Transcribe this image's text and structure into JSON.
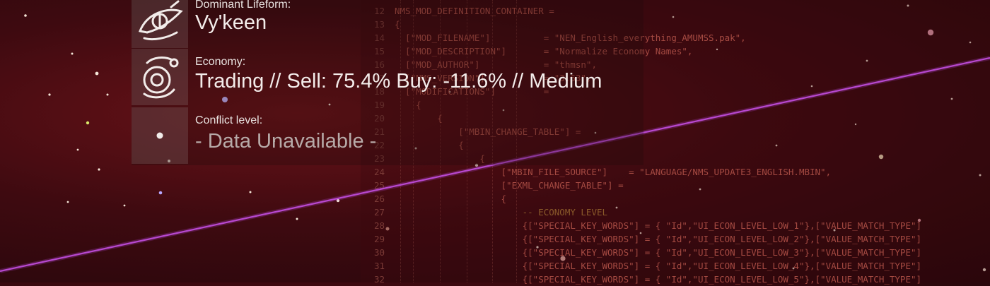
{
  "hud": {
    "rows": [
      {
        "label": "Dominant Lifeform:",
        "value": "Vy'keen",
        "icon": "vykeen-eye-icon"
      },
      {
        "label": "Economy:",
        "value": "Trading // Sell: 75.4% Buy: -11.6% // Medium",
        "icon": "trading-economy-icon"
      },
      {
        "label": "Conflict level:",
        "value": "- Data Unavailable -",
        "icon": "conflict-unknown-icon"
      }
    ]
  },
  "editor": {
    "lines": [
      {
        "num": "12",
        "text": "NMS_MOD_DEFINITION_CONTAINER ="
      },
      {
        "num": "13",
        "text": "{"
      },
      {
        "num": "14",
        "text": "  [\"MOD_FILENAME\"]          = \"NEN_English_everything_AMUMSS.pak\","
      },
      {
        "num": "15",
        "text": "  [\"MOD_DESCRIPTION\"]       = \"Normalize Economy Names\","
      },
      {
        "num": "16",
        "text": "  [\"MOD_AUTHOR\"]            = \"thmsn\","
      },
      {
        "num": "17",
        "text": "  [\"NMS_VERSION\"]           = \"3.63\","
      },
      {
        "num": "18",
        "text": "  [\"MODIFICATIONS\"]         ="
      },
      {
        "num": "19",
        "text": "    {"
      },
      {
        "num": "20",
        "text": "        {"
      },
      {
        "num": "21",
        "text": "            [\"MBIN_CHANGE_TABLE\"] ="
      },
      {
        "num": "22",
        "text": "            {"
      },
      {
        "num": "23",
        "text": "                {"
      },
      {
        "num": "24",
        "text": "                    [\"MBIN_FILE_SOURCE\"]    = \"LANGUAGE/NMS_UPDATE3_ENGLISH.MBIN\","
      },
      {
        "num": "25",
        "text": "                    [\"EXML_CHANGE_TABLE\"] ="
      },
      {
        "num": "26",
        "text": "                    {"
      },
      {
        "num": "27",
        "text": "                        -- ECONOMY LEVEL",
        "comment": true
      },
      {
        "num": "28",
        "text": "                        {[\"SPECIAL_KEY_WORDS\"] = { \"Id\",\"UI_ECON_LEVEL_LOW_1\"},[\"VALUE_MATCH_TYPE\"]"
      },
      {
        "num": "29",
        "text": "                        {[\"SPECIAL_KEY_WORDS\"] = { \"Id\",\"UI_ECON_LEVEL_LOW_2\"},[\"VALUE_MATCH_TYPE\"]"
      },
      {
        "num": "30",
        "text": "                        {[\"SPECIAL_KEY_WORDS\"] = { \"Id\",\"UI_ECON_LEVEL_LOW_3\"},[\"VALUE_MATCH_TYPE\"]"
      },
      {
        "num": "31",
        "text": "                        {[\"SPECIAL_KEY_WORDS\"] = { \"Id\",\"UI_ECON_LEVEL_LOW_4\"},[\"VALUE_MATCH_TYPE\"]"
      },
      {
        "num": "32",
        "text": "                        {[\"SPECIAL_KEY_WORDS\"] = { \"Id\",\"UI_ECON_LEVEL_LOW_5\"},[\"VALUE_MATCH_TYPE\"]"
      }
    ]
  }
}
